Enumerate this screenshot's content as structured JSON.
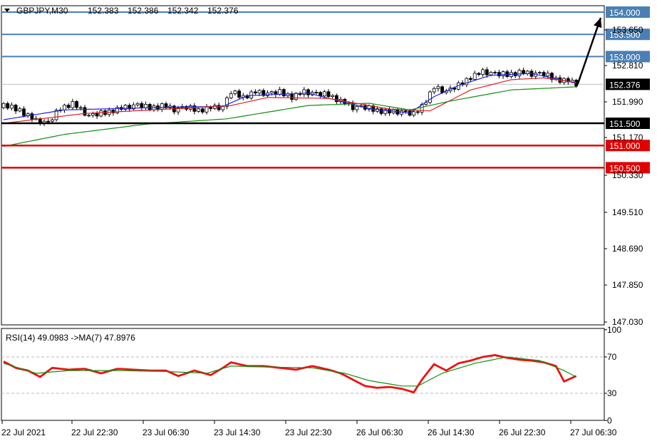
{
  "colors": {
    "level_blue": "#4a7fb5",
    "level_black": "#000000",
    "level_red": "#e00000",
    "ma_fast": "#2020ee",
    "ma_mid": "#e02020",
    "ma_slow": "#109010",
    "rsi": "#ee1111",
    "rsi_ma": "#109010",
    "current_price_line": "#c0c0c0"
  },
  "header": {
    "symbol": "GBPJPY,M30",
    "ohlc": [
      "152.383",
      "152.386",
      "152.342",
      "152.376"
    ]
  },
  "chart_data": [
    {
      "type": "candlestick",
      "symbol": "GBPJPY",
      "timeframe": "M30",
      "ylim": [
        146.9,
        154.2
      ],
      "y_ticks": [
        "153.650",
        "152.810",
        "151.990",
        "151.170",
        "150.330",
        "149.510",
        "148.690",
        "147.850",
        "147.030"
      ],
      "x_ticks": [
        "22 Jul 2021",
        "22 Jul 22:30",
        "23 Jul 06:30",
        "23 Jul 14:30",
        "23 Jul 22:30",
        "26 Jul 06:30",
        "26 Jul 14:30",
        "26 Jul 22:30",
        "27 Jul 06:30"
      ],
      "current_price": "152.376",
      "levels": [
        {
          "price": 154.0,
          "label": "154.000",
          "color": "blue"
        },
        {
          "price": 153.5,
          "label": "153.500",
          "color": "blue"
        },
        {
          "price": 153.0,
          "label": "153.000",
          "color": "blue"
        },
        {
          "price": 151.5,
          "label": "151.500",
          "color": "black"
        },
        {
          "price": 151.0,
          "label": "151.000",
          "color": "red"
        },
        {
          "price": 150.5,
          "label": "150.500",
          "color": "red"
        }
      ],
      "close_anchors": [
        [
          0,
          151.9
        ],
        [
          4,
          151.8
        ],
        [
          8,
          151.55
        ],
        [
          11,
          151.5
        ],
        [
          14,
          151.85
        ],
        [
          17,
          151.95
        ],
        [
          21,
          151.65
        ],
        [
          24,
          151.72
        ],
        [
          27,
          151.8
        ],
        [
          30,
          151.85
        ],
        [
          33,
          151.9
        ],
        [
          36,
          151.85
        ],
        [
          39,
          151.9
        ],
        [
          42,
          151.8
        ],
        [
          45,
          151.85
        ],
        [
          48,
          151.8
        ],
        [
          51,
          151.85
        ],
        [
          54,
          151.85
        ],
        [
          56,
          152.2
        ],
        [
          59,
          152.1
        ],
        [
          62,
          152.2
        ],
        [
          65,
          152.15
        ],
        [
          68,
          152.2
        ],
        [
          71,
          152.1
        ],
        [
          74,
          152.2
        ],
        [
          77,
          152.15
        ],
        [
          80,
          152.15
        ],
        [
          83,
          152.0
        ],
        [
          86,
          151.85
        ],
        [
          89,
          151.85
        ],
        [
          92,
          151.8
        ],
        [
          95,
          151.75
        ],
        [
          98,
          151.75
        ],
        [
          101,
          151.7
        ],
        [
          103,
          151.9
        ],
        [
          106,
          152.3
        ],
        [
          109,
          152.2
        ],
        [
          112,
          152.35
        ],
        [
          115,
          152.55
        ],
        [
          118,
          152.65
        ],
        [
          121,
          152.6
        ],
        [
          124,
          152.6
        ],
        [
          127,
          152.65
        ],
        [
          130,
          152.6
        ],
        [
          133,
          152.6
        ],
        [
          136,
          152.5
        ],
        [
          139,
          152.45
        ],
        [
          141,
          152.38
        ]
      ],
      "moving_averages": [
        {
          "color": "blue",
          "anchors": [
            [
              0,
              151.58
            ],
            [
              15,
              151.8
            ],
            [
              40,
              151.86
            ],
            [
              54,
              151.88
            ],
            [
              60,
              152.12
            ],
            [
              75,
              152.18
            ],
            [
              90,
              151.83
            ],
            [
              100,
              151.73
            ],
            [
              106,
              152.1
            ],
            [
              112,
              152.35
            ],
            [
              120,
              152.58
            ],
            [
              130,
              152.62
            ],
            [
              141,
              152.4
            ]
          ]
        },
        {
          "color": "red",
          "anchors": [
            [
              0,
              151.5
            ],
            [
              20,
              151.72
            ],
            [
              45,
              151.84
            ],
            [
              56,
              151.9
            ],
            [
              65,
              152.08
            ],
            [
              80,
              152.06
            ],
            [
              95,
              151.82
            ],
            [
              105,
              151.78
            ],
            [
              115,
              152.25
            ],
            [
              125,
              152.48
            ],
            [
              133,
              152.52
            ],
            [
              141,
              152.42
            ]
          ]
        },
        {
          "color": "green",
          "anchors": [
            [
              0,
              150.98
            ],
            [
              15,
              151.25
            ],
            [
              35,
              151.48
            ],
            [
              55,
              151.6
            ],
            [
              75,
              151.9
            ],
            [
              90,
              151.95
            ],
            [
              100,
              151.8
            ],
            [
              110,
              152.0
            ],
            [
              125,
              152.25
            ],
            [
              141,
              152.32
            ]
          ]
        }
      ],
      "projection": {
        "from_bar": 141,
        "from_price": 152.38,
        "to_price": 154.0
      }
    },
    {
      "type": "line",
      "title": "RSI(14) 49.0983 ->MA(7) 47.8976",
      "ylim": [
        -5,
        105
      ],
      "y_ticks": [
        "100",
        "70",
        "30",
        "0"
      ],
      "levels": [
        70,
        30
      ],
      "series": [
        {
          "color": "red",
          "anchors": [
            [
              0,
              65
            ],
            [
              3,
              58
            ],
            [
              6,
              55
            ],
            [
              9,
              48
            ],
            [
              12,
              58
            ],
            [
              16,
              56
            ],
            [
              20,
              57
            ],
            [
              24,
              52
            ],
            [
              28,
              57
            ],
            [
              32,
              56
            ],
            [
              36,
              55
            ],
            [
              40,
              55
            ],
            [
              43,
              49
            ],
            [
              47,
              55
            ],
            [
              51,
              50
            ],
            [
              54,
              58
            ],
            [
              56,
              64
            ],
            [
              60,
              60
            ],
            [
              64,
              60
            ],
            [
              68,
              58
            ],
            [
              72,
              56
            ],
            [
              76,
              60
            ],
            [
              80,
              56
            ],
            [
              83,
              52
            ],
            [
              86,
              45
            ],
            [
              89,
              38
            ],
            [
              92,
              36
            ],
            [
              95,
              37
            ],
            [
              98,
              35
            ],
            [
              101,
              31
            ],
            [
              103,
              45
            ],
            [
              106,
              62
            ],
            [
              109,
              55
            ],
            [
              112,
              63
            ],
            [
              115,
              66
            ],
            [
              118,
              70
            ],
            [
              121,
              72
            ],
            [
              124,
              69
            ],
            [
              127,
              67
            ],
            [
              130,
              66
            ],
            [
              133,
              64
            ],
            [
              136,
              60
            ],
            [
              138,
              43
            ],
            [
              141,
              49
            ]
          ]
        },
        {
          "color": "green",
          "anchors": [
            [
              0,
              63
            ],
            [
              8,
              52
            ],
            [
              16,
              55
            ],
            [
              28,
              55
            ],
            [
              40,
              54
            ],
            [
              50,
              52
            ],
            [
              56,
              60
            ],
            [
              64,
              59
            ],
            [
              76,
              58
            ],
            [
              84,
              52
            ],
            [
              90,
              44
            ],
            [
              98,
              38
            ],
            [
              102,
              38
            ],
            [
              108,
              52
            ],
            [
              116,
              63
            ],
            [
              124,
              70
            ],
            [
              132,
              66
            ],
            [
              138,
              55
            ],
            [
              141,
              48
            ]
          ]
        }
      ]
    }
  ]
}
